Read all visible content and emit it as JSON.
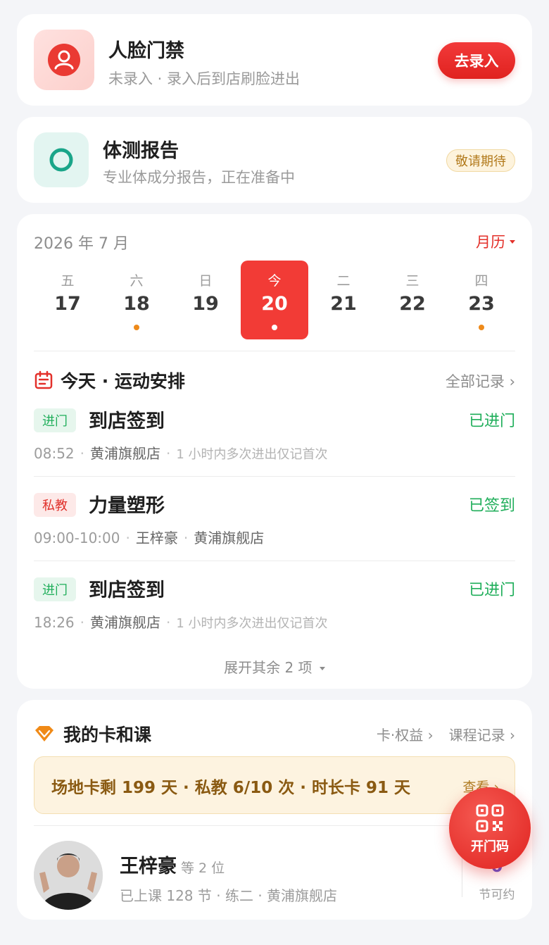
{
  "face_access": {
    "title": "人脸门禁",
    "subtitle": "未录入 · 录入后到店刷脸进出",
    "button": "去录入",
    "icon": "user-icon",
    "accent": "#e8322c"
  },
  "body_report": {
    "title": "体测报告",
    "subtitle": "专业体成分报告，正在准备中",
    "badge": "敬请期待",
    "icon": "ring-icon",
    "accent": "#1aa589"
  },
  "calendar": {
    "month": "2026 年 7 月",
    "link": "月历",
    "days": [
      {
        "weekday": "五",
        "date": "17",
        "dot": false,
        "today": false
      },
      {
        "weekday": "六",
        "date": "18",
        "dot": true,
        "today": false
      },
      {
        "weekday": "日",
        "date": "19",
        "dot": false,
        "today": false
      },
      {
        "weekday": "今",
        "date": "20",
        "dot": true,
        "today": true
      },
      {
        "weekday": "二",
        "date": "21",
        "dot": false,
        "today": false
      },
      {
        "weekday": "三",
        "date": "22",
        "dot": false,
        "today": false
      },
      {
        "weekday": "四",
        "date": "23",
        "dot": true,
        "today": false
      }
    ]
  },
  "schedule": {
    "title": "今天 · 运动安排",
    "more": "全部记录 ›",
    "entries": [
      {
        "tag": "进门",
        "tag_color": "green",
        "title": "到店签到",
        "status": "已进门",
        "time": "08:52",
        "place": "黄浦旗舰店",
        "note": "1 小时内多次进出仅记首次"
      },
      {
        "tag": "私教",
        "tag_color": "red",
        "title": "力量塑形",
        "status": "已签到",
        "time": "09:00-10:00",
        "coach": "王梓豪",
        "place": "黄浦旗舰店"
      },
      {
        "tag": "进门",
        "tag_color": "green",
        "title": "到店签到",
        "status": "已进门",
        "time": "18:26",
        "place": "黄浦旗舰店",
        "note": "1 小时内多次进出仅记首次"
      }
    ],
    "expand": "展开其余 2 项"
  },
  "my_cards": {
    "title": "我的卡和课",
    "link_benefits": "卡·权益 ›",
    "link_records": "课程记录 ›",
    "summary": "场地卡剩 199 天 · 私教 6/10 次 · 时长卡 91 天",
    "summary_link": "查看 ›",
    "coach_name": "王梓豪",
    "coach_extra": "等 2 位",
    "coach_meta": "已上课 128 节 · 练二 · 黄浦旗舰店",
    "bookable_num": "0",
    "bookable_label": "节可约"
  },
  "fab": {
    "label": "开门码",
    "icon": "qr-code-icon"
  }
}
